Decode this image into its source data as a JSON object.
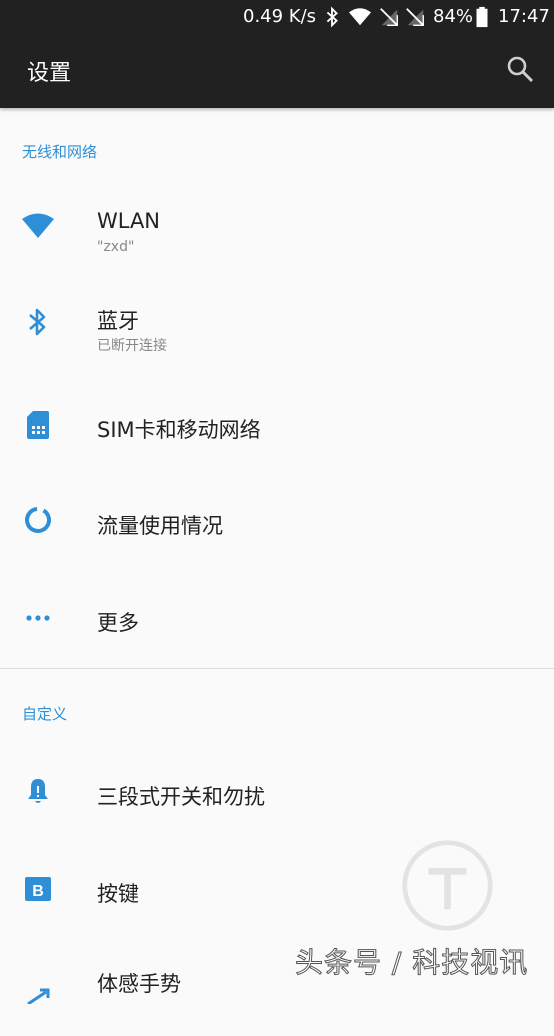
{
  "colors": {
    "accent": "#2e8fd6",
    "header_bg": "#212121",
    "background": "#fafafa"
  },
  "status_bar": {
    "net_speed": "0.49 K/s",
    "battery": "84%",
    "time": "17:47",
    "icons": [
      "bluetooth-icon",
      "wifi-signal-icon",
      "sim1-no-signal-icon",
      "sim2-no-signal-icon",
      "battery-icon"
    ]
  },
  "app_bar": {
    "title": "设置",
    "search_icon": "search-icon"
  },
  "sections": {
    "wireless": {
      "header": "无线和网络",
      "items": [
        {
          "title": "WLAN",
          "subtitle": "\"zxd\"",
          "icon": "wifi-icon"
        },
        {
          "title": "蓝牙",
          "subtitle": "已断开连接",
          "icon": "bluetooth-icon"
        },
        {
          "title": "SIM卡和移动网络",
          "icon": "sim-card-icon"
        },
        {
          "title": "流量使用情况",
          "icon": "data-usage-icon"
        },
        {
          "title": "更多",
          "icon": "more-dots-icon"
        }
      ]
    },
    "custom": {
      "header": "自定义",
      "items": [
        {
          "title": "三段式开关和勿扰",
          "icon": "bell-icon"
        },
        {
          "title": "按键",
          "icon": "buttons-b-icon"
        },
        {
          "title": "体感手势",
          "icon": "gesture-icon"
        }
      ]
    }
  },
  "watermark": {
    "text": "头条号 / 科技视讯"
  }
}
